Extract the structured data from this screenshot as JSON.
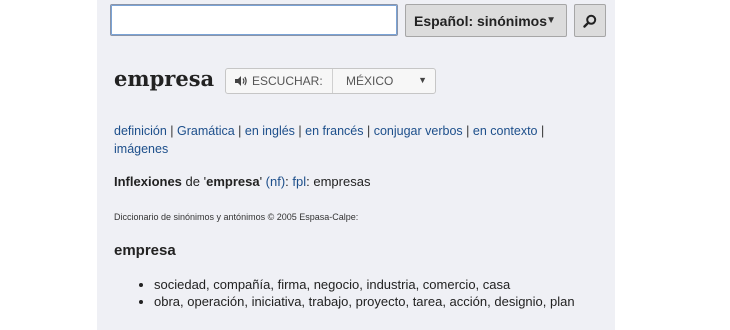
{
  "search": {
    "value": "",
    "placeholder": "",
    "language_label": "Español: sinónimos"
  },
  "entry": {
    "headword": "empresa",
    "listen_label": "ESCUCHAR:",
    "region": "MÉXICO"
  },
  "links": [
    "definición",
    "Gramática",
    "en inglés",
    "en francés",
    "conjugar verbos",
    "en contexto",
    "imágenes"
  ],
  "inflections": {
    "label": "Inflexiones",
    "de": " de '",
    "word": "empresa",
    "close": "' ",
    "pos": "(nf)",
    "colon": ": ",
    "plural_tag": "fpl",
    "plural_colon": ": ",
    "plural": "empresas"
  },
  "source": "Diccionario de sinónimos y antónimos © 2005 Espasa-Calpe:",
  "section": {
    "title": "empresa",
    "synonyms": [
      "sociedad, compañía, firma, negocio, industria, comercio, casa",
      "obra, operación, iniciativa, trabajo, proyecto, tarea, acción, designio, plan"
    ]
  },
  "icons": {
    "search": "magnifier-icon",
    "speaker": "speaker-icon",
    "caret": "caret-down-icon"
  },
  "colors": {
    "panel_bg": "#eff0f5",
    "link": "#1d4f8b",
    "button_bg": "#dcdcdc"
  }
}
